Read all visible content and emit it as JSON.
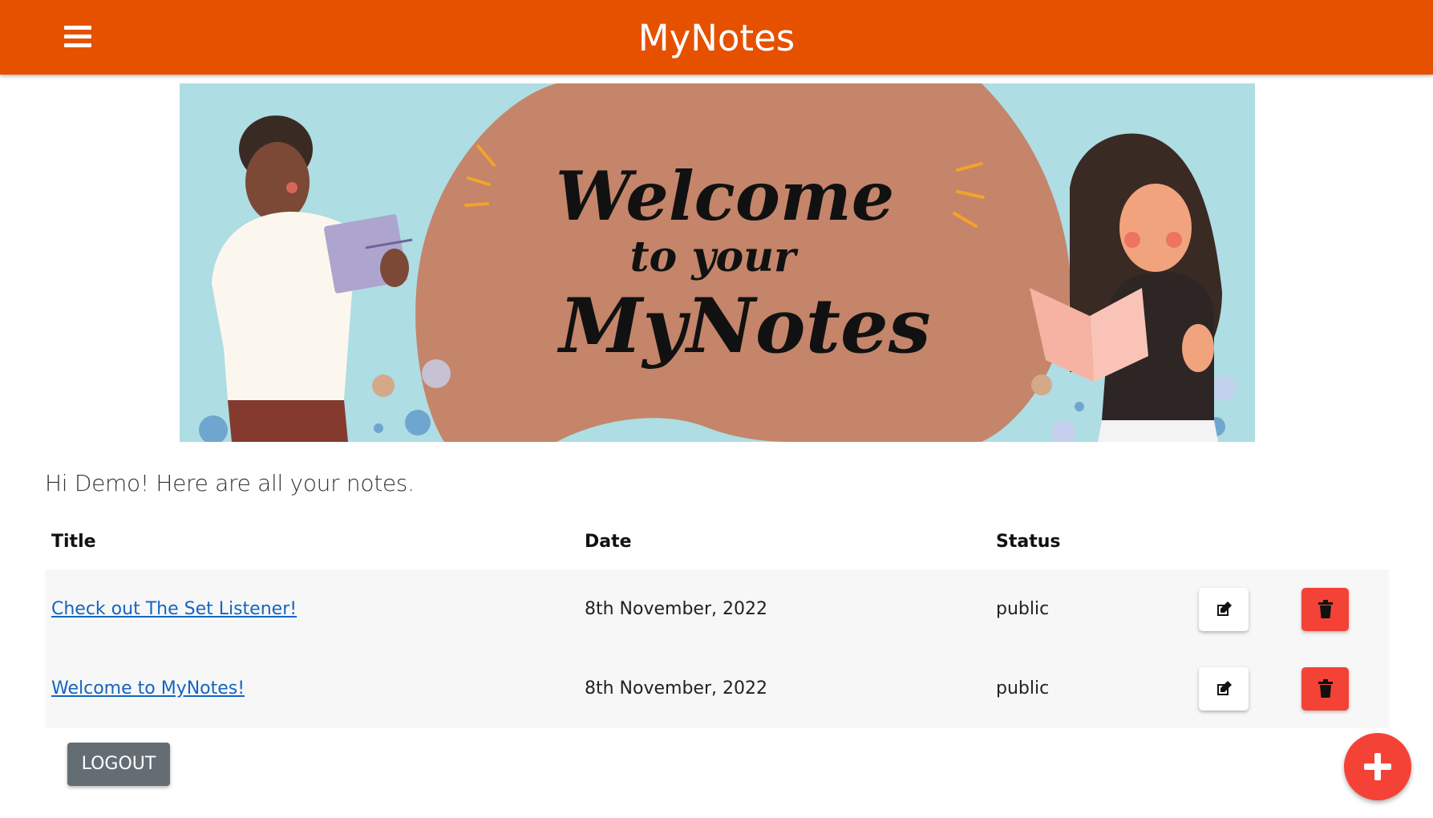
{
  "app": {
    "title": "MyNotes"
  },
  "navbar": {
    "menu_icon": "hamburger-menu-icon"
  },
  "banner": {
    "lines": [
      "Welcome",
      "to your",
      "MyNotes"
    ],
    "colors": {
      "sky": "#aedde3",
      "blob": "#c4856a"
    }
  },
  "greeting": "Hi Demo! Here are all your notes.",
  "table": {
    "headers": {
      "title": "Title",
      "date": "Date",
      "status": "Status"
    },
    "rows": [
      {
        "title": "Check out The Set Listener!",
        "date": "8th November, 2022",
        "status": "public"
      },
      {
        "title": "Welcome to MyNotes!",
        "date": "8th November, 2022",
        "status": "public"
      }
    ]
  },
  "buttons": {
    "logout": "LOGOUT",
    "add_icon": "plus-icon",
    "edit_icon": "edit-icon",
    "delete_icon": "trash-icon"
  },
  "colors": {
    "primary": "#e65100",
    "danger": "#f44336",
    "link": "#1565c0",
    "secondary": "#656d74"
  }
}
